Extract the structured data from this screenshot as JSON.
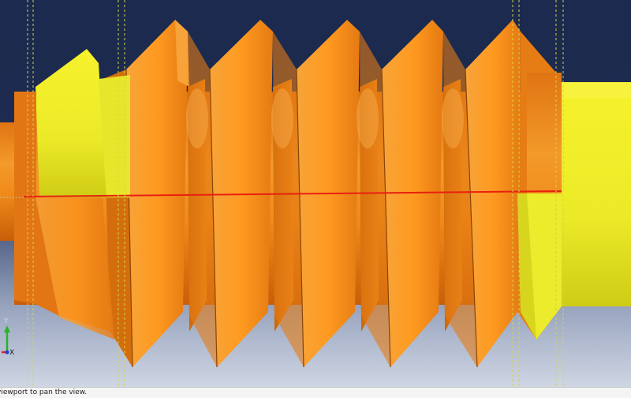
{
  "viewport": {
    "background_top": "#1b2a4e",
    "background_bottom": "#c9d2e0",
    "thread_color": "#f08a1a",
    "yellow_color": "#f1ef2a",
    "section_line_color": "#e82010",
    "guide_line_color": "#d6d24a"
  },
  "triad": {
    "y_label": "Y",
    "x_label": "X",
    "y_color": "#28b428",
    "x_color": "#e02020",
    "z_color": "#2040d8"
  },
  "status_bar": {
    "text": "viewport to pan the view."
  }
}
